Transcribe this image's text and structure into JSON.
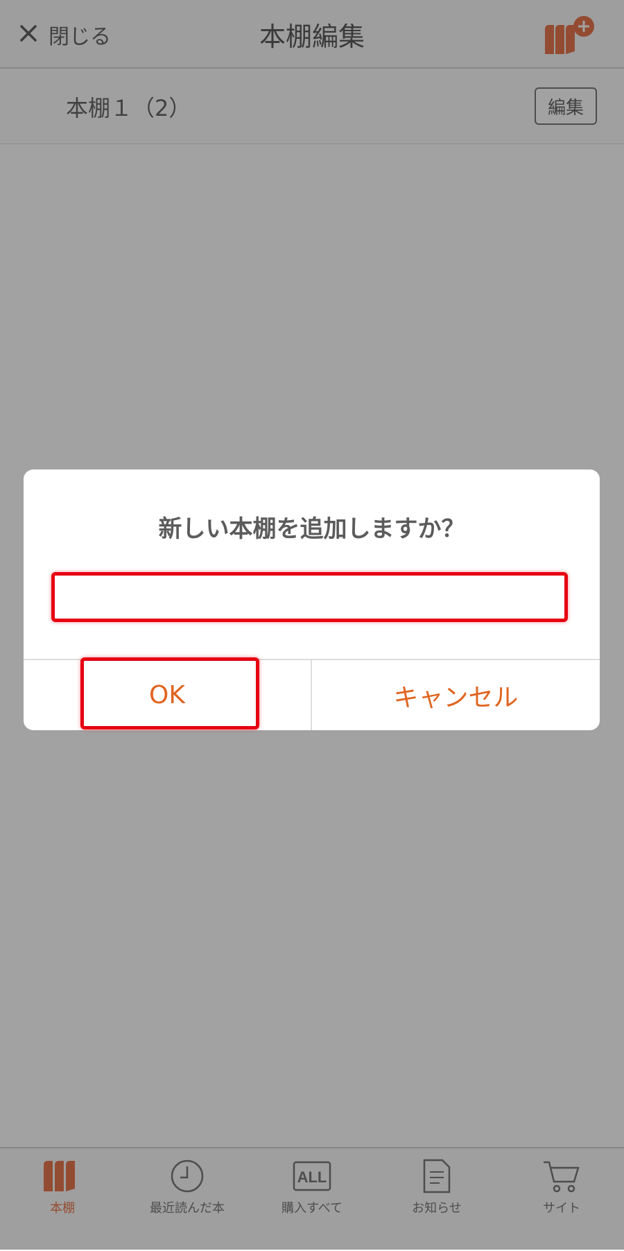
{
  "navbar": {
    "close_label": "閉じる",
    "title": "本棚編集",
    "add_shelf_icon": "bookshelf-add-icon"
  },
  "shelf": {
    "name": "本棚１（2）",
    "edit_label": "編集"
  },
  "dialog": {
    "title": "新しい本棚を追加しますか？",
    "input_value": "",
    "ok_label": "OK",
    "cancel_label": "キャンセル",
    "highlight_color": "#e60012"
  },
  "tabbar": {
    "items": [
      {
        "label": "本棚",
        "icon": "bookshelf-icon",
        "active": true
      },
      {
        "label": "最近読んだ本",
        "icon": "clock-icon",
        "active": false
      },
      {
        "label": "購入すべて",
        "icon": "all-icon",
        "active": false
      },
      {
        "label": "お知らせ",
        "icon": "document-icon",
        "active": false
      },
      {
        "label": "サイト",
        "icon": "cart-icon",
        "active": false
      }
    ]
  },
  "colors": {
    "accent": "#e0521f",
    "overlay": "rgba(70,70,70,0.5)"
  }
}
